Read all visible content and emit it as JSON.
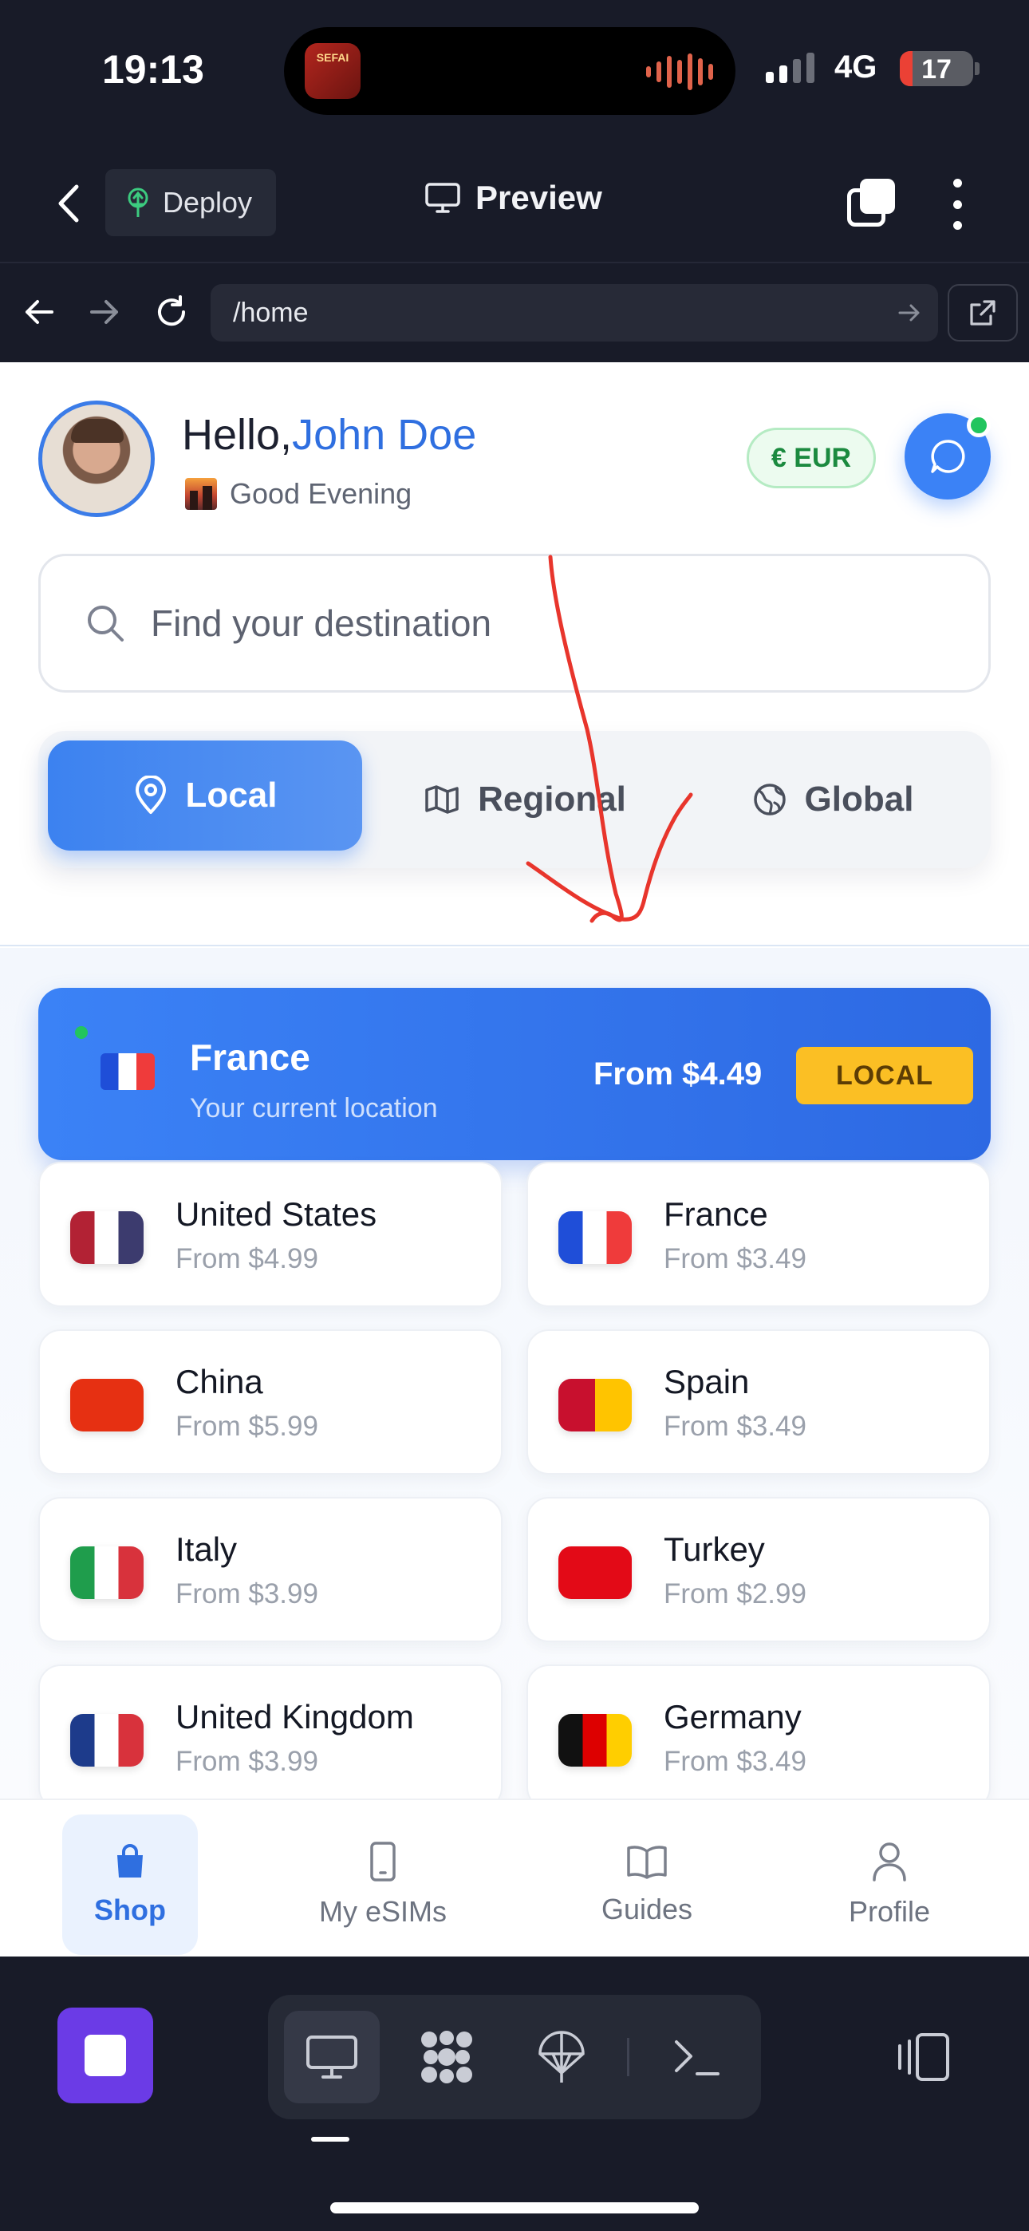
{
  "status_bar": {
    "time": "19:13",
    "network": "4G",
    "battery": "17",
    "battery_level": 0.17,
    "island_app_label": "SEFAI"
  },
  "toolbar": {
    "deploy_label": "Deploy",
    "preview_label": "Preview"
  },
  "browser": {
    "url": "/home"
  },
  "header": {
    "greeting_prefix": "Hello,",
    "user_name": "John Doe",
    "sub_greeting": "Good Evening",
    "currency": "€ EUR"
  },
  "search": {
    "placeholder": "Find your destination"
  },
  "tabs": [
    {
      "label": "Local",
      "icon": "map-pin-icon",
      "active": true
    },
    {
      "label": "Regional",
      "icon": "map-icon",
      "active": false
    },
    {
      "label": "Global",
      "icon": "globe-icon",
      "active": false
    }
  ],
  "current_location": {
    "name": "France",
    "subtitle": "Your current location",
    "price": "From $4.49",
    "badge": "LOCAL"
  },
  "countries": [
    {
      "name": "United States",
      "price": "From $4.99"
    },
    {
      "name": "France",
      "price": "From $3.49"
    },
    {
      "name": "China",
      "price": "From $5.99"
    },
    {
      "name": "Spain",
      "price": "From $3.49"
    },
    {
      "name": "Italy",
      "price": "From $3.99"
    },
    {
      "name": "Turkey",
      "price": "From $2.99"
    },
    {
      "name": "United Kingdom",
      "price": "From $3.99"
    },
    {
      "name": "Germany",
      "price": "From $3.49"
    }
  ],
  "bottom_nav": [
    {
      "label": "Shop",
      "icon": "shopping-bag-icon",
      "active": true
    },
    {
      "label": "My eSIMs",
      "icon": "smartphone-icon",
      "active": false
    },
    {
      "label": "Guides",
      "icon": "book-icon",
      "active": false
    },
    {
      "label": "Profile",
      "icon": "user-icon",
      "active": false
    }
  ],
  "colors": {
    "primary": "#3b82f6",
    "accent_green": "#22c55e",
    "badge_yellow": "#fbbf24",
    "annotation_red": "#e8352c",
    "dock_purple": "#6b3be6"
  }
}
